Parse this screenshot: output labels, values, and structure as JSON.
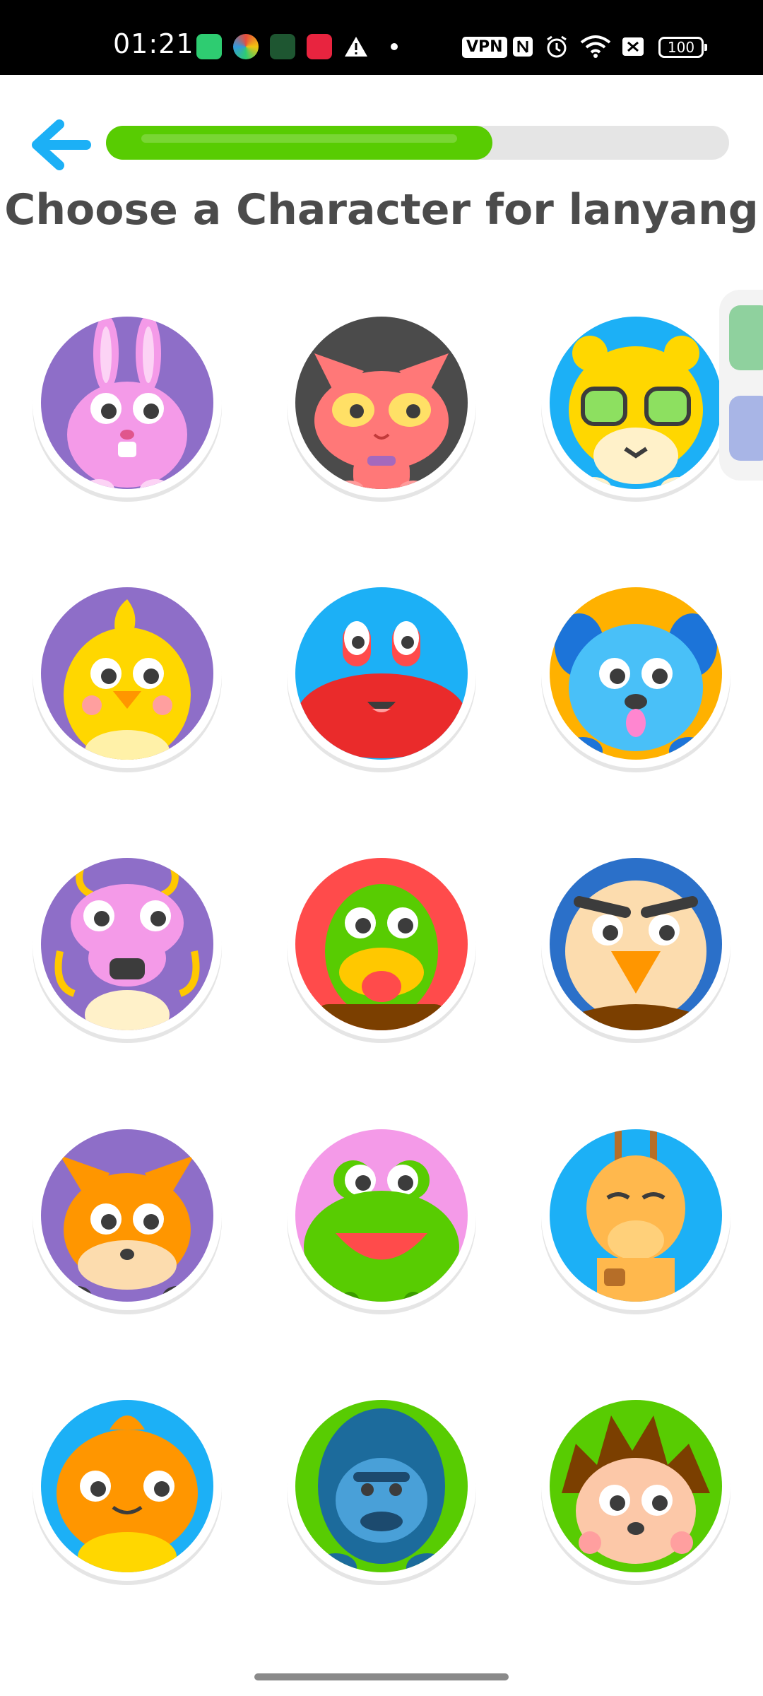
{
  "status_bar": {
    "time": "01:21",
    "vpn_label": "VPN",
    "battery_level": "100",
    "icons": [
      "shield-app-icon",
      "colorful-app-icon",
      "cube-app-icon",
      "red-app-icon",
      "warning-icon",
      "dot-icon",
      "nfc-icon",
      "alarm-icon",
      "wifi-icon",
      "sim-off-icon"
    ]
  },
  "header": {
    "progress_fraction": 0.62,
    "title": "Choose a Character for lanyang"
  },
  "characters": [
    {
      "name": "rabbit",
      "bg": "#8e6ec8"
    },
    {
      "name": "cat",
      "bg": "#4b4b4b"
    },
    {
      "name": "leopard",
      "bg": "#1cb0f6"
    },
    {
      "name": "chick",
      "bg": "#8e6ec8"
    },
    {
      "name": "crab",
      "bg": "#1cb0f6"
    },
    {
      "name": "dog",
      "bg": "#ffb100"
    },
    {
      "name": "dragon",
      "bg": "#8e6ec8"
    },
    {
      "name": "duck",
      "bg": "#ff4b4b"
    },
    {
      "name": "eagle",
      "bg": "#2b70c9"
    },
    {
      "name": "fox",
      "bg": "#8e6ec8"
    },
    {
      "name": "frog",
      "bg": "#f49ae8"
    },
    {
      "name": "giraffe",
      "bg": "#1cb0f6"
    },
    {
      "name": "owl",
      "bg": "#1cb0f6"
    },
    {
      "name": "gorilla",
      "bg": "#58cc02"
    },
    {
      "name": "hedgehog",
      "bg": "#58cc02"
    }
  ],
  "colors": {
    "accent_blue": "#1cb0f6",
    "progress_green": "#58cc02",
    "title_gray": "#4b4b4b"
  }
}
